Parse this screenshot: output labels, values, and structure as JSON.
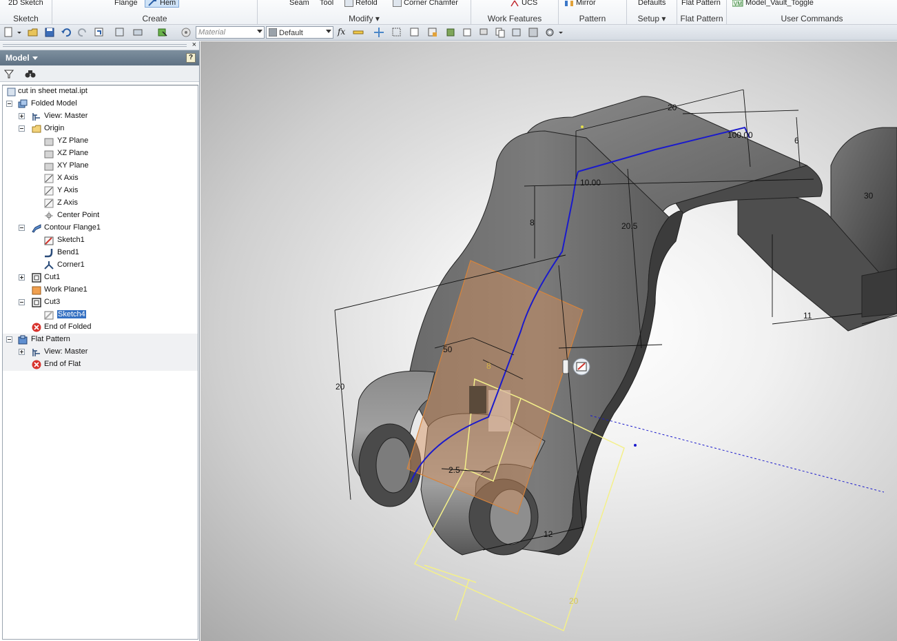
{
  "ribbon": {
    "groups": [
      {
        "label": "Sketch",
        "commands": [
          "2D Sketch"
        ]
      },
      {
        "label": "Create",
        "commands": [
          "Flange",
          "Hem"
        ]
      },
      {
        "label": "Modify",
        "commands": [
          "Seam",
          "Tool",
          "Refold",
          "Corner Chamfer"
        ]
      },
      {
        "label": "Work Features",
        "commands": [
          "UCS"
        ]
      },
      {
        "label": "Pattern",
        "commands": [
          "Mirror"
        ]
      },
      {
        "label": "Setup",
        "commands": [
          "Defaults"
        ]
      },
      {
        "label": "Flat Pattern",
        "commands": [
          "Flat Pattern"
        ]
      },
      {
        "label": "User Commands",
        "commands": [
          "Model_Vault_Toggle"
        ]
      }
    ]
  },
  "quickbar": {
    "material_placeholder": "Material",
    "appearance_value": "Default",
    "function_label": "fx"
  },
  "browser": {
    "title": "Model",
    "close_glyph": "×",
    "help_glyph": "?",
    "tree": [
      {
        "label": "cut in sheet metal.ipt",
        "icon": "part-file-icon"
      },
      {
        "label": "Folded Model",
        "icon": "folded-model-icon"
      },
      {
        "label": "View: Master",
        "icon": "view-icon"
      },
      {
        "label": "Origin",
        "icon": "folder-icon"
      },
      {
        "label": "YZ Plane",
        "icon": "plane-icon"
      },
      {
        "label": "XZ Plane",
        "icon": "plane-icon"
      },
      {
        "label": "XY Plane",
        "icon": "plane-icon"
      },
      {
        "label": "X Axis",
        "icon": "axis-icon"
      },
      {
        "label": "Y Axis",
        "icon": "axis-icon"
      },
      {
        "label": "Z Axis",
        "icon": "axis-icon"
      },
      {
        "label": "Center Point",
        "icon": "point-icon"
      },
      {
        "label": "Contour Flange1",
        "icon": "contour-flange-icon"
      },
      {
        "label": "Sketch1",
        "icon": "sketch-icon"
      },
      {
        "label": "Bend1",
        "icon": "bend-icon"
      },
      {
        "label": "Corner1",
        "icon": "corner-icon"
      },
      {
        "label": "Cut1",
        "icon": "cut-icon"
      },
      {
        "label": "Work Plane1",
        "icon": "work-plane-icon"
      },
      {
        "label": "Cut3",
        "icon": "cut-icon"
      },
      {
        "label": "Sketch4",
        "icon": "sketch-icon"
      },
      {
        "label": "End of Folded",
        "icon": "end-of-part-icon"
      },
      {
        "label": "Flat Pattern",
        "icon": "flat-pattern-icon"
      },
      {
        "label": "View: Master",
        "icon": "view-icon"
      },
      {
        "label": "End of Flat",
        "icon": "end-of-part-icon"
      }
    ]
  },
  "viewport": {
    "dimensions": [
      "20",
      "100.00",
      "6",
      "10.00",
      "8",
      "20.5",
      "30",
      "11",
      "50",
      "8",
      "20",
      "2.5",
      "12",
      "20"
    ],
    "colors": {
      "sketch_path": "#1a1acc",
      "selection_outline": "#f4f08a",
      "work_plane": "#c08a5a",
      "part_body": "#6b6b6b"
    }
  }
}
